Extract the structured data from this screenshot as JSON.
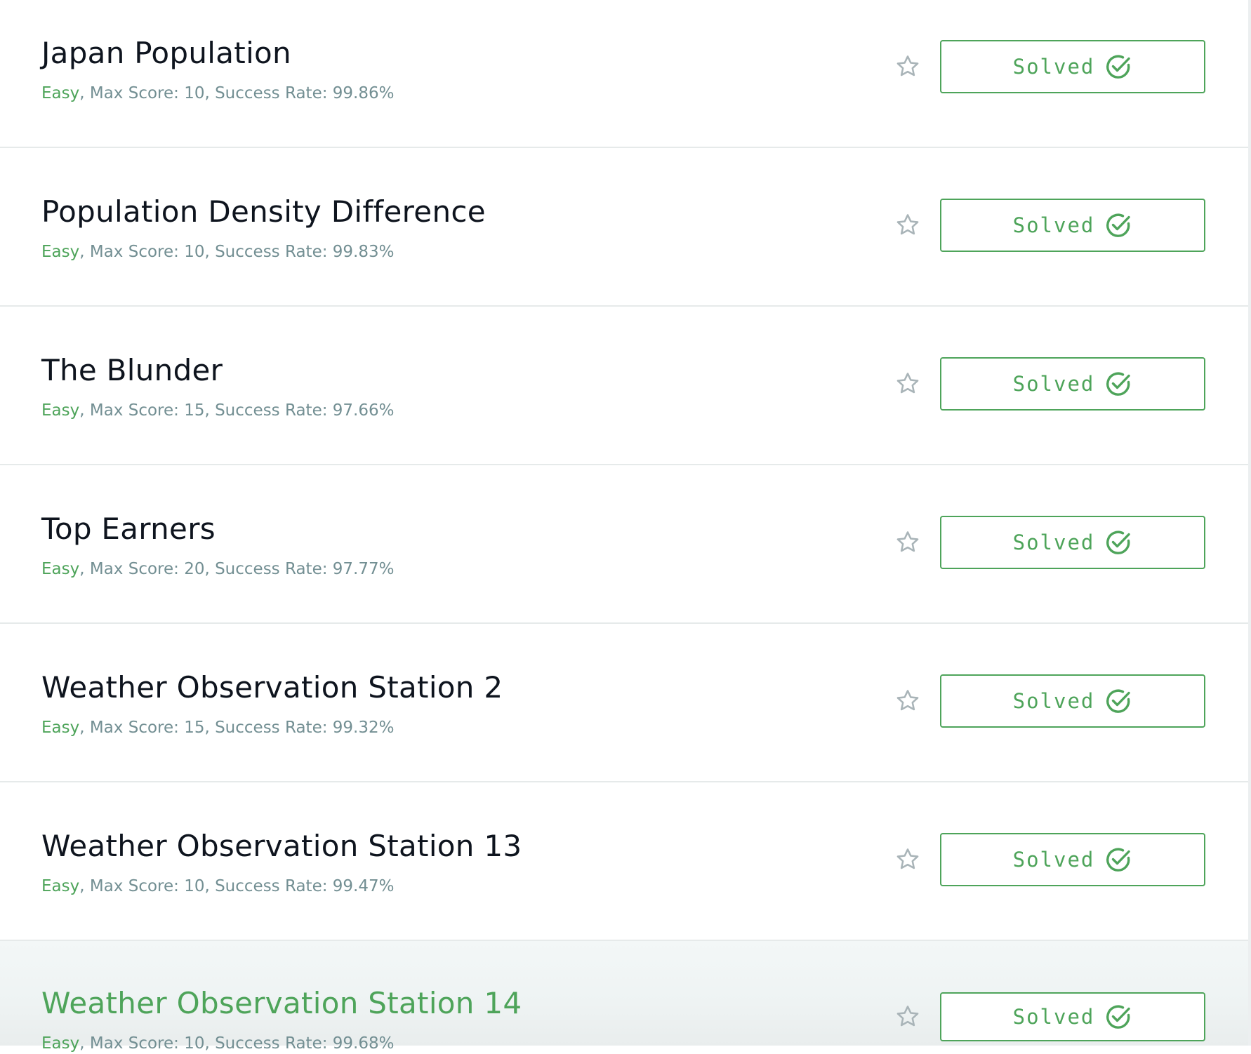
{
  "theme": {
    "accent": "#4ea45a",
    "title_color": "#0e141e",
    "meta_color": "#738f93",
    "divider": "#e6eaea"
  },
  "challenges": [
    {
      "title": "Japan Population",
      "difficulty": "Easy",
      "details": ", Max Score: 10, Success Rate: 99.86%",
      "status": "Solved",
      "icons": {
        "bookmark": "star-outline-icon",
        "status": "check-circle-icon"
      }
    },
    {
      "title": "Population Density Difference",
      "difficulty": "Easy",
      "details": ", Max Score: 10, Success Rate: 99.83%",
      "status": "Solved",
      "icons": {
        "bookmark": "star-outline-icon",
        "status": "check-circle-icon"
      }
    },
    {
      "title": "The Blunder",
      "difficulty": "Easy",
      "details": ", Max Score: 15, Success Rate: 97.66%",
      "status": "Solved",
      "icons": {
        "bookmark": "star-outline-icon",
        "status": "check-circle-icon"
      }
    },
    {
      "title": "Top Earners",
      "difficulty": "Easy",
      "details": ", Max Score: 20, Success Rate: 97.77%",
      "status": "Solved",
      "icons": {
        "bookmark": "star-outline-icon",
        "status": "check-circle-icon"
      }
    },
    {
      "title": "Weather Observation Station 2",
      "difficulty": "Easy",
      "details": ", Max Score: 15, Success Rate: 99.32%",
      "status": "Solved",
      "icons": {
        "bookmark": "star-outline-icon",
        "status": "check-circle-icon"
      }
    },
    {
      "title": "Weather Observation Station 13",
      "difficulty": "Easy",
      "details": ", Max Score: 10, Success Rate: 99.47%",
      "status": "Solved",
      "icons": {
        "bookmark": "star-outline-icon",
        "status": "check-circle-icon"
      }
    },
    {
      "title": "Weather Observation Station 14",
      "difficulty": "Easy",
      "details": ", Max Score: 10, Success Rate: 99.68%",
      "status": "Solved",
      "hovered": true,
      "icons": {
        "bookmark": "star-outline-icon",
        "status": "check-circle-icon"
      }
    }
  ]
}
